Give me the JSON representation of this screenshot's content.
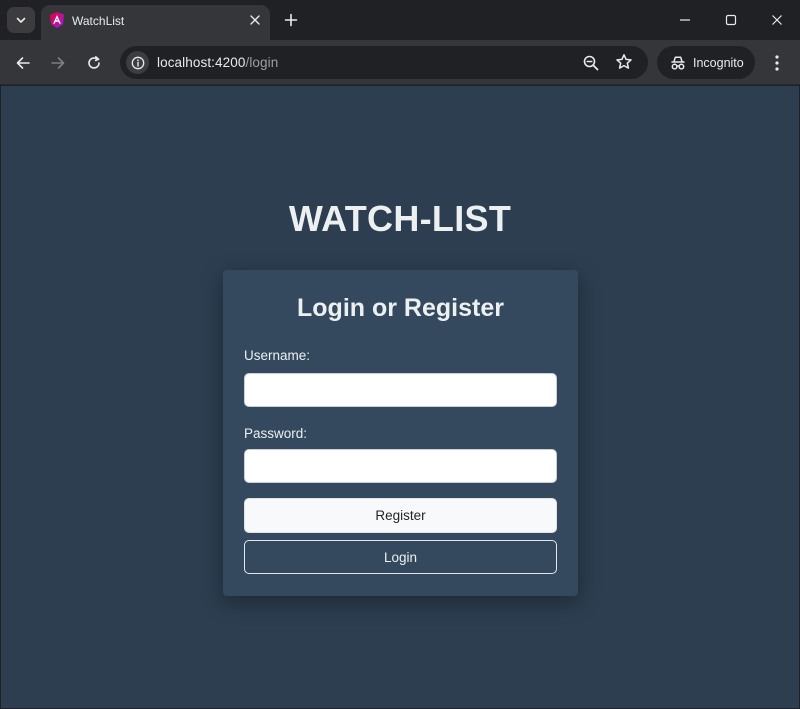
{
  "browser": {
    "tab": {
      "title": "WatchList"
    },
    "address_bar": {
      "host": "localhost:4200",
      "path": "/login"
    },
    "profile": {
      "label": "Incognito"
    }
  },
  "app": {
    "title": "WATCH-LIST",
    "login_card": {
      "heading": "Login or Register",
      "username_label": "Username:",
      "username_value": "",
      "password_label": "Password:",
      "password_value": "",
      "register_label": "Register",
      "login_label": "Login"
    }
  },
  "colors": {
    "page_background": "#2c3e50",
    "card_background": "#34495e",
    "text": "#ecf0f1",
    "browser_frame": "#202124",
    "browser_toolbar": "#35363a"
  }
}
